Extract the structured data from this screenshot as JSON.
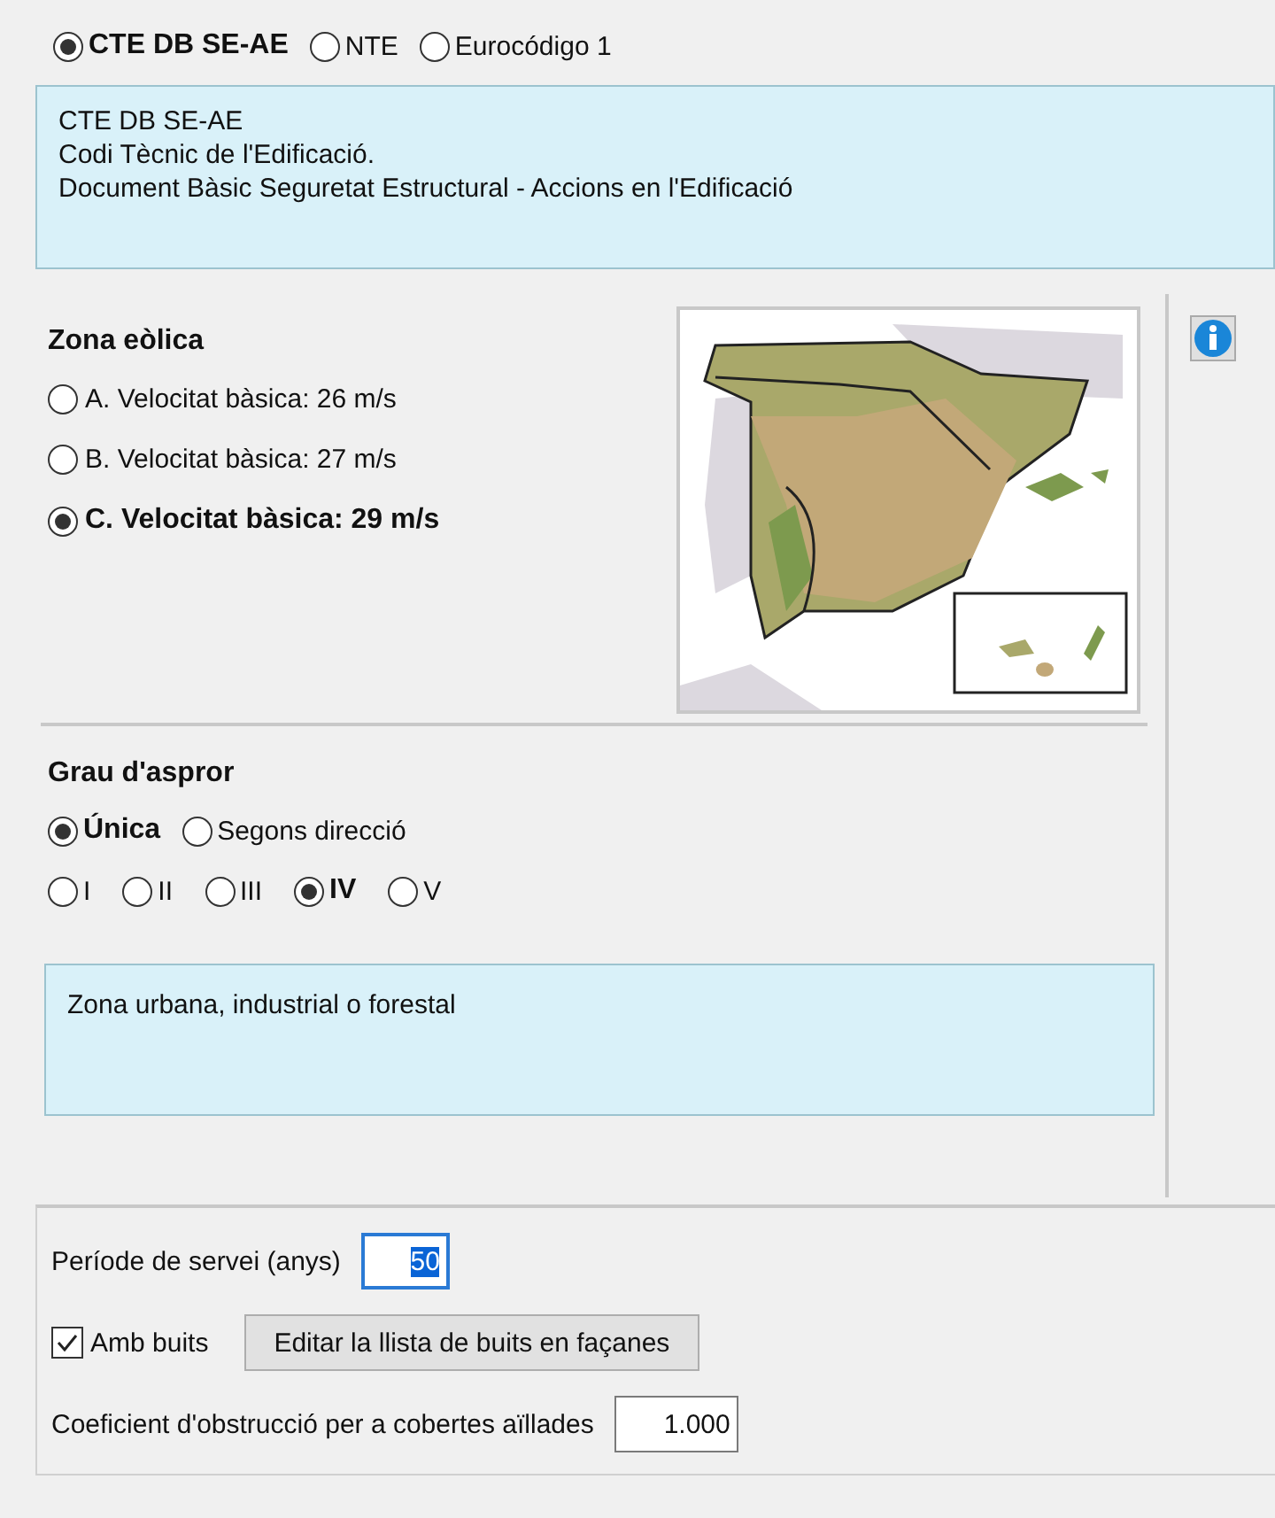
{
  "standards": [
    {
      "label": "CTE DB SE-AE",
      "selected": true
    },
    {
      "label": "NTE",
      "selected": false
    },
    {
      "label": "Eurocódigo 1",
      "selected": false
    }
  ],
  "description": [
    "CTE DB SE-AE",
    "Codi Tècnic de l'Edificació.",
    "Document Bàsic Seguretat Estructural - Accions en l'Edificació"
  ],
  "wind_zone": {
    "title": "Zona eòlica",
    "options": [
      {
        "label": "A. Velocitat bàsica: 26 m/s",
        "selected": false
      },
      {
        "label": "B. Velocitat bàsica: 27 m/s",
        "selected": false
      },
      {
        "label": "C. Velocitat bàsica: 29 m/s",
        "selected": true
      }
    ]
  },
  "roughness": {
    "title": "Grau d'aspror",
    "modes": [
      {
        "label": "Única",
        "selected": true
      },
      {
        "label": "Segons direcció",
        "selected": false
      }
    ],
    "levels": [
      {
        "label": "I",
        "selected": false
      },
      {
        "label": "II",
        "selected": false
      },
      {
        "label": "III",
        "selected": false
      },
      {
        "label": "IV",
        "selected": true
      },
      {
        "label": "V",
        "selected": false
      }
    ],
    "description": "Zona urbana, industrial o forestal"
  },
  "service_period": {
    "label": "Període de servei (anys)",
    "value": "50"
  },
  "openings": {
    "label": "Amb buits",
    "checked": true,
    "button": "Editar la llista de buits en façanes"
  },
  "obstruction": {
    "label": "Coeficient d'obstrucció per a cobertes aïllades",
    "value": "1.000"
  }
}
